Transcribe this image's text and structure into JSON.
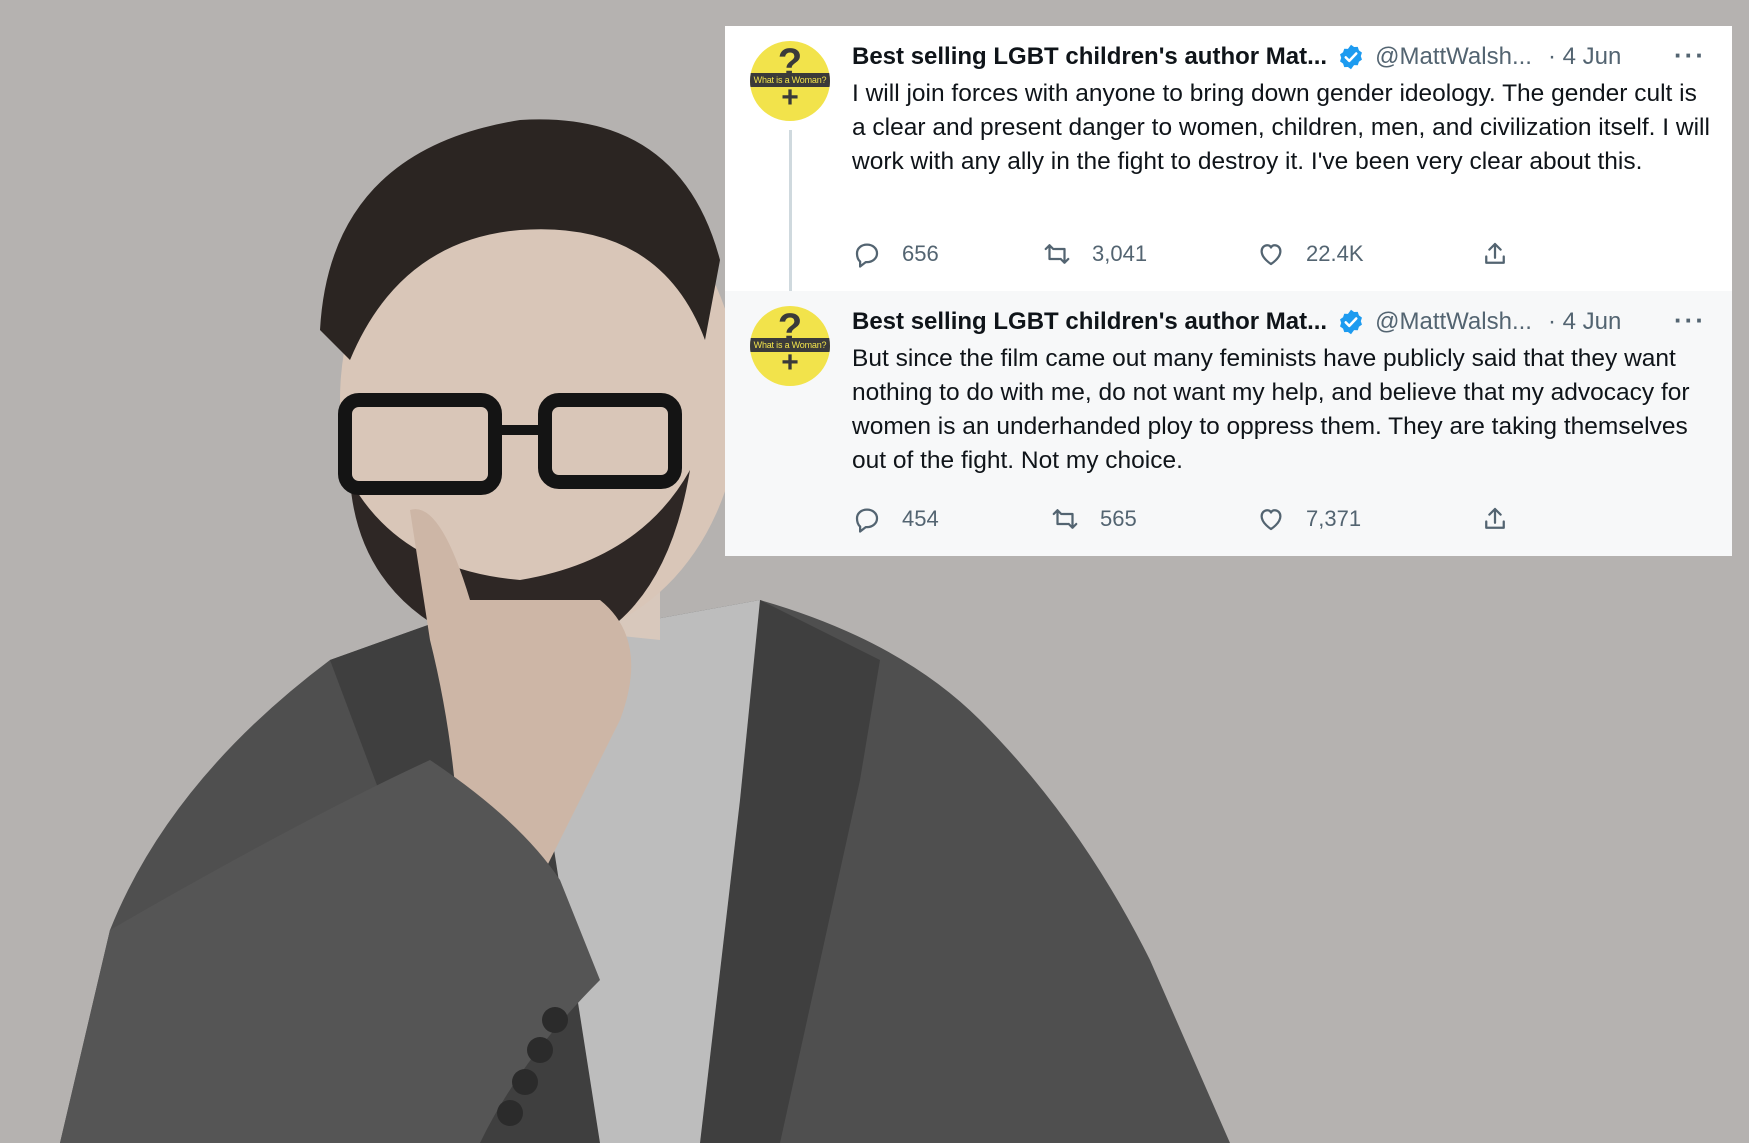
{
  "background_photo": {
    "description_icon": "man-in-suit-photo-icon",
    "color": "#b5b2b0"
  },
  "tweets": [
    {
      "author_name": "Best selling LGBT children's author Mat...",
      "handle": "@MattWalsh...",
      "date": "· 4 Jun",
      "more": "···",
      "avatar_text": "What is a Woman?",
      "text": "I will join forces with anyone to bring down gender ideology. The gender cult is a clear and present danger to women, children, men, and civilization itself. I will work with any ally in the fight to destroy it. I've been very clear about this.",
      "replies": "656",
      "retweets": "3,041",
      "likes": "22.4K"
    },
    {
      "author_name": "Best selling LGBT children's author Mat...",
      "handle": "@MattWalsh...",
      "date": "· 4 Jun",
      "more": "···",
      "avatar_text": "What is a Woman?",
      "text": "But since the film came out many feminists have publicly said that they want nothing to do with me, do not want my help, and believe that my advocacy for women is an underhanded ploy to oppress them. They are taking themselves out of the fight. Not my choice.",
      "replies": "454",
      "retweets": "565",
      "likes": "7,371"
    }
  ],
  "colors": {
    "avatar_yellow": "#f2e34b",
    "verified_blue": "#1d9bf0",
    "secondary_text": "#536471"
  }
}
